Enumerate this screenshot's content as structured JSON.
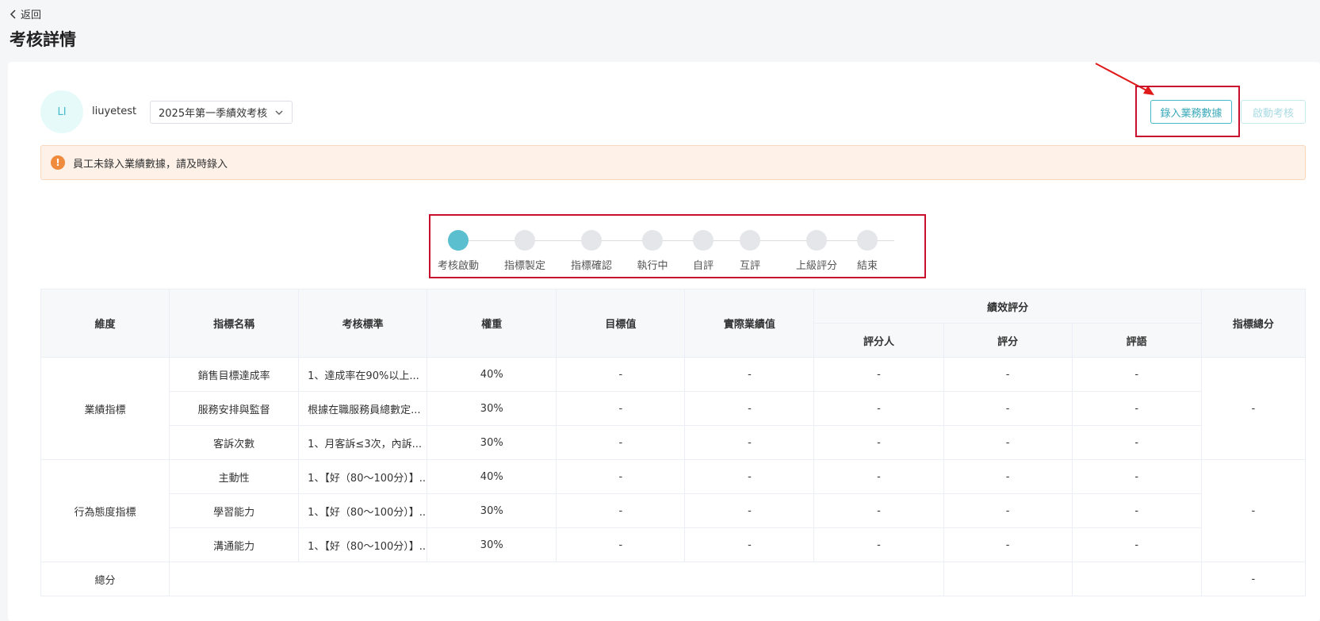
{
  "header": {
    "back_label": "返回",
    "title": "考核詳情"
  },
  "employee": {
    "avatar_initials": "LI",
    "name": "liuyetest",
    "period": "2025年第一季績效考核"
  },
  "actions": {
    "record_label": "錄入業務數據",
    "start_label": "啟動考核"
  },
  "alert": {
    "icon": "!",
    "text": "員工未錄入業績數據，請及時錄入"
  },
  "steps": [
    {
      "label": "考核啟動",
      "active": true
    },
    {
      "label": "指標製定",
      "active": false
    },
    {
      "label": "指標確認",
      "active": false
    },
    {
      "label": "執行中",
      "active": false
    },
    {
      "label": "自評",
      "active": false
    },
    {
      "label": "互評",
      "active": false
    },
    {
      "label": "上級評分",
      "active": false
    },
    {
      "label": "結束",
      "active": false
    }
  ],
  "table": {
    "headers": {
      "dimension": "維度",
      "name": "指標名稱",
      "standard": "考核標準",
      "weight": "權重",
      "target": "目標值",
      "actual": "實際業績值",
      "performance": "績效評分",
      "rater": "評分人",
      "score": "評分",
      "comment": "評語",
      "total": "指標總分"
    },
    "groups": [
      {
        "dimension": "業績指標",
        "total": "-",
        "rows": [
          {
            "name": "銷售目標達成率",
            "standard": "1、達成率在90%以上...",
            "weight": "40%",
            "target": "-",
            "actual": "-",
            "rater": "-",
            "score": "-",
            "comment": "-"
          },
          {
            "name": "服務安排與監督",
            "standard": "根據在職服務員總數定...",
            "weight": "30%",
            "target": "-",
            "actual": "-",
            "rater": "-",
            "score": "-",
            "comment": "-"
          },
          {
            "name": "客訴次數",
            "standard": "1、月客訴≤3次，內訴...",
            "weight": "30%",
            "target": "-",
            "actual": "-",
            "rater": "-",
            "score": "-",
            "comment": "-"
          }
        ]
      },
      {
        "dimension": "行為態度指標",
        "total": "-",
        "rows": [
          {
            "name": "主動性",
            "standard": "1、【好（80〜100分）】...",
            "weight": "40%",
            "target": "-",
            "actual": "-",
            "rater": "-",
            "score": "-",
            "comment": "-"
          },
          {
            "name": "學習能力",
            "standard": "1、【好（80〜100分）】...",
            "weight": "30%",
            "target": "-",
            "actual": "-",
            "rater": "-",
            "score": "-",
            "comment": "-"
          },
          {
            "name": "溝通能力",
            "standard": "1、【好（80〜100分）】...",
            "weight": "30%",
            "target": "-",
            "actual": "-",
            "rater": "-",
            "score": "-",
            "comment": "-"
          }
        ]
      }
    ],
    "footer": {
      "label": "總分",
      "total": "-"
    }
  }
}
